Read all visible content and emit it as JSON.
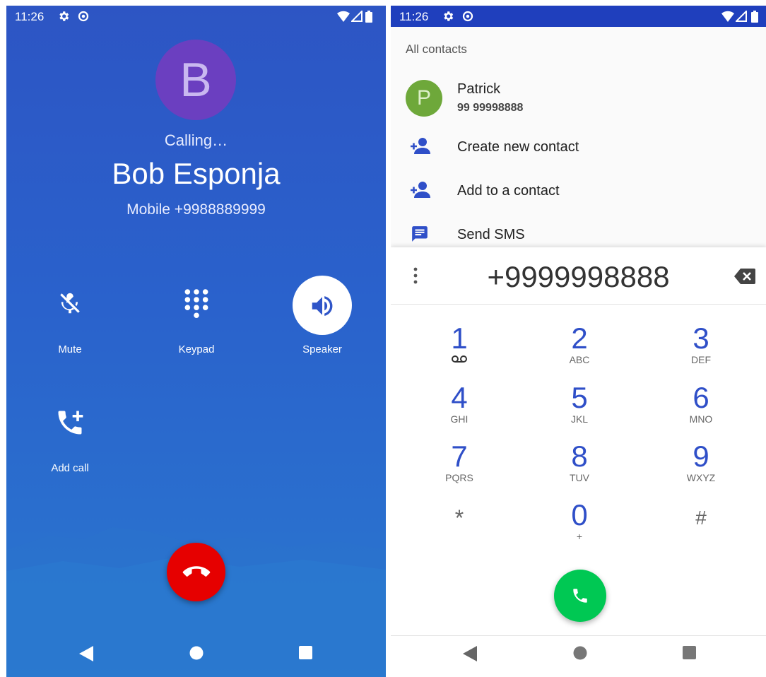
{
  "left": {
    "status": {
      "time": "11:26"
    },
    "avatar_letter": "B",
    "calling_text": "Calling…",
    "callee_name": "Bob Esponja",
    "callee_number": "Mobile +9988889999",
    "controls": {
      "mute": "Mute",
      "keypad": "Keypad",
      "speaker": "Speaker",
      "add_call": "Add call"
    },
    "colors": {
      "end_call": "#e60000",
      "avatar": "#6b3fc0"
    }
  },
  "right": {
    "status": {
      "time": "11:26"
    },
    "section_header": "All contacts",
    "contact": {
      "initial": "P",
      "name": "Patrick",
      "number": "99 99998888"
    },
    "actions": {
      "create": "Create new contact",
      "add": "Add to a contact",
      "sms": "Send SMS"
    },
    "dialed_number": "+9999998888",
    "keys": [
      {
        "digit": "1",
        "letters": ""
      },
      {
        "digit": "2",
        "letters": "ABC"
      },
      {
        "digit": "3",
        "letters": "DEF"
      },
      {
        "digit": "4",
        "letters": "GHI"
      },
      {
        "digit": "5",
        "letters": "JKL"
      },
      {
        "digit": "6",
        "letters": "MNO"
      },
      {
        "digit": "7",
        "letters": "PQRS"
      },
      {
        "digit": "8",
        "letters": "TUV"
      },
      {
        "digit": "9",
        "letters": "WXYZ"
      },
      {
        "digit": "*",
        "letters": ""
      },
      {
        "digit": "0",
        "letters": "+"
      },
      {
        "digit": "#",
        "letters": ""
      }
    ],
    "colors": {
      "call_button": "#00c853",
      "accent": "#2f4fc8"
    }
  }
}
